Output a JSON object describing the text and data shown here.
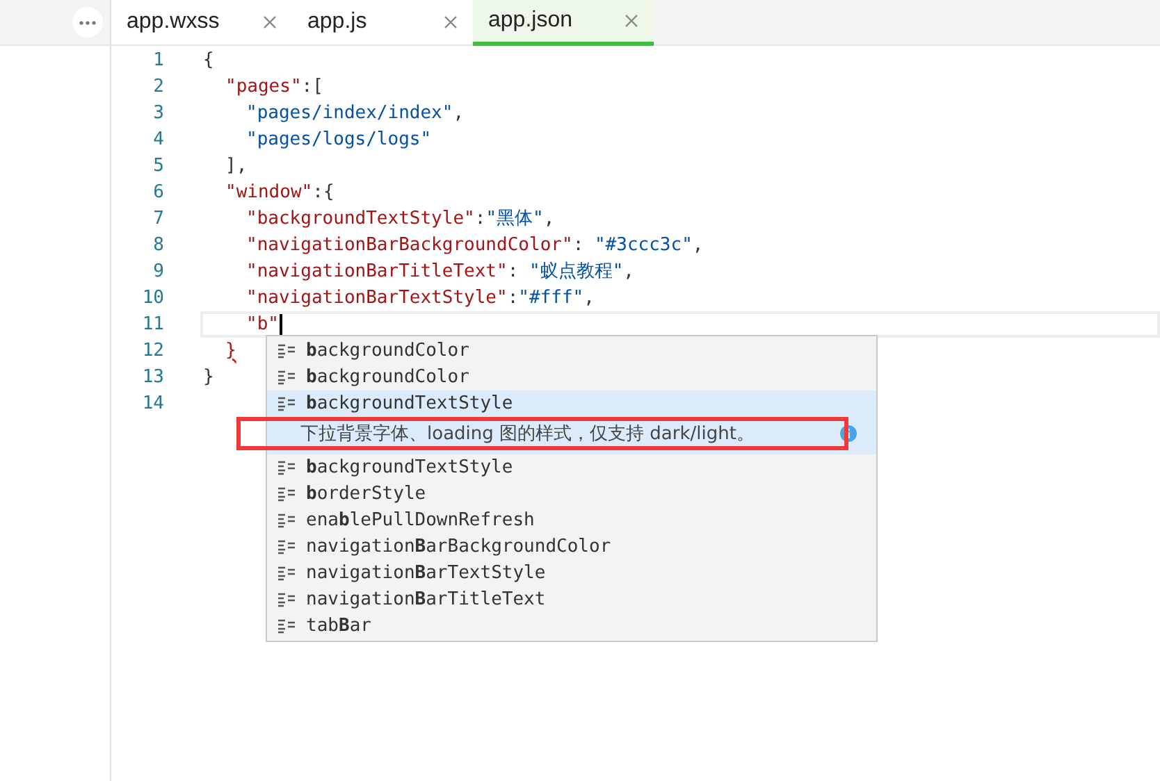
{
  "tabs": [
    {
      "label": "app.wxss",
      "selected": false
    },
    {
      "label": "app.js",
      "selected": false
    },
    {
      "label": "app.json",
      "selected": true
    }
  ],
  "code_lines": [
    {
      "number": "1",
      "current": false,
      "kind": "root",
      "tokens": [
        {
          "kind": "punct",
          "text": "{"
        }
      ]
    },
    {
      "number": "2",
      "current": false,
      "kind": "nested",
      "tokens": [
        {
          "kind": "key",
          "text": "\"pages\""
        },
        {
          "kind": "punct",
          "text": ":["
        }
      ]
    },
    {
      "number": "3",
      "current": false,
      "kind": "deep",
      "tokens": [
        {
          "kind": "string",
          "text": "\"pages/index/index\""
        },
        {
          "kind": "punct",
          "text": ","
        }
      ]
    },
    {
      "number": "4",
      "current": false,
      "kind": "deep",
      "tokens": [
        {
          "kind": "string",
          "text": "\"pages/logs/logs\""
        }
      ]
    },
    {
      "number": "5",
      "current": false,
      "kind": "nested",
      "tokens": [
        {
          "kind": "punct",
          "text": "],"
        }
      ]
    },
    {
      "number": "6",
      "current": false,
      "kind": "nested",
      "tokens": [
        {
          "kind": "key",
          "text": "\"window\""
        },
        {
          "kind": "punct",
          "text": ":{"
        }
      ]
    },
    {
      "number": "7",
      "current": false,
      "kind": "deep",
      "tokens": [
        {
          "kind": "key",
          "text": "\"backgroundTextStyle\""
        },
        {
          "kind": "punct",
          "text": ":"
        },
        {
          "kind": "string",
          "text": "\"黑体\""
        },
        {
          "kind": "punct",
          "text": ","
        }
      ]
    },
    {
      "number": "8",
      "current": false,
      "kind": "deep",
      "tokens": [
        {
          "kind": "key",
          "text": "\"navigationBarBackgroundColor\""
        },
        {
          "kind": "punct",
          "text": ": "
        },
        {
          "kind": "string",
          "text": "\"#3ccc3c\""
        },
        {
          "kind": "punct",
          "text": ","
        }
      ]
    },
    {
      "number": "9",
      "current": false,
      "kind": "deep",
      "tokens": [
        {
          "kind": "key",
          "text": "\"navigationBarTitleText\""
        },
        {
          "kind": "punct",
          "text": ": "
        },
        {
          "kind": "string",
          "text": "\"蚁点教程\""
        },
        {
          "kind": "punct",
          "text": ","
        }
      ]
    },
    {
      "number": "10",
      "current": false,
      "kind": "deep",
      "tokens": [
        {
          "kind": "key",
          "text": "\"navigationBarTextStyle\""
        },
        {
          "kind": "punct",
          "text": ":"
        },
        {
          "kind": "string",
          "text": "\"#fff\""
        },
        {
          "kind": "punct",
          "text": ","
        }
      ]
    },
    {
      "number": "11",
      "current": true,
      "kind": "deep",
      "tokens": [
        {
          "kind": "key",
          "text": "\"b\""
        }
      ]
    },
    {
      "number": "12",
      "current": false,
      "kind": "nested",
      "tokens": [
        {
          "kind": "error",
          "text": "}"
        }
      ]
    },
    {
      "number": "13",
      "current": false,
      "kind": "root",
      "tokens": [
        {
          "kind": "punct",
          "text": "}"
        }
      ]
    },
    {
      "number": "14",
      "current": false,
      "kind": "root"
    }
  ],
  "suggestions": [
    {
      "label": "**b**ackgroundColor",
      "selected": false
    },
    {
      "label": "**b**ackgroundColor",
      "selected": false
    },
    {
      "label": "**b**ackgroundTextStyle",
      "selected": true,
      "detail": "下拉背景字体、loading 图的样式，仅支持 dark/light。"
    },
    {
      "label": "**b**ackgroundTextStyle",
      "selected": false
    },
    {
      "label": "**b**orderStyle",
      "selected": false
    },
    {
      "label": "ena**b**lePullDownRefresh",
      "selected": false
    },
    {
      "label": "navigation**B**arBackgroundColor",
      "selected": false
    },
    {
      "label": "navigation**B**arTextStyle",
      "selected": false
    },
    {
      "label": "navigation**B**arTitleText",
      "selected": false
    },
    {
      "label": "tab**B**ar",
      "selected": false
    }
  ]
}
